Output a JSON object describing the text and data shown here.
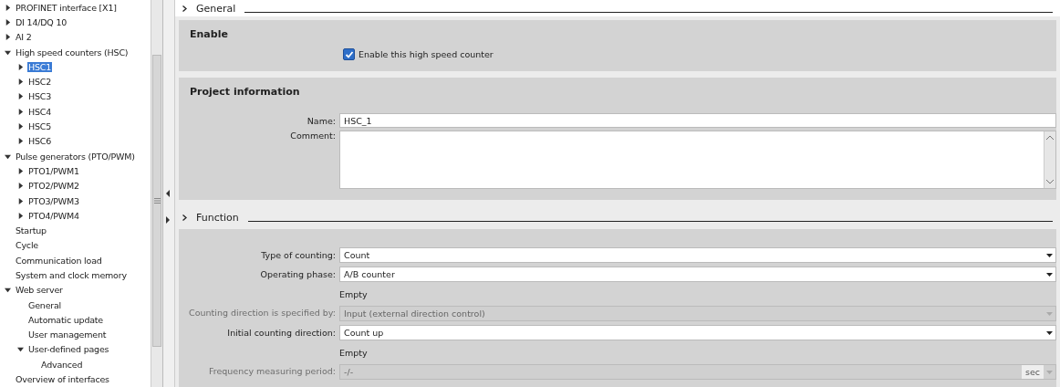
{
  "tree": [
    {
      "label": "PROFINET interface [X1]",
      "kind": "folder",
      "expanded": false,
      "selected": false
    },
    {
      "label": "DI 14/DQ 10",
      "kind": "folder",
      "expanded": false,
      "selected": false
    },
    {
      "label": "AI 2",
      "kind": "folder",
      "expanded": false,
      "selected": false
    },
    {
      "label": "High speed counters (HSC)",
      "kind": "folder",
      "expanded": true,
      "selected": false,
      "children": [
        {
          "label": "HSC1",
          "kind": "folder",
          "expanded": false,
          "selected": true
        },
        {
          "label": "HSC2",
          "kind": "folder",
          "expanded": false,
          "selected": false
        },
        {
          "label": "HSC3",
          "kind": "folder",
          "expanded": false,
          "selected": false
        },
        {
          "label": "HSC4",
          "kind": "folder",
          "expanded": false,
          "selected": false
        },
        {
          "label": "HSC5",
          "kind": "folder",
          "expanded": false,
          "selected": false
        },
        {
          "label": "HSC6",
          "kind": "folder",
          "expanded": false,
          "selected": false
        }
      ]
    },
    {
      "label": "Pulse generators (PTO/PWM)",
      "kind": "folder",
      "expanded": true,
      "selected": false,
      "children": [
        {
          "label": "PTO1/PWM1",
          "kind": "folder",
          "expanded": false,
          "selected": false
        },
        {
          "label": "PTO2/PWM2",
          "kind": "folder",
          "expanded": false,
          "selected": false
        },
        {
          "label": "PTO3/PWM3",
          "kind": "folder",
          "expanded": false,
          "selected": false
        },
        {
          "label": "PTO4/PWM4",
          "kind": "folder",
          "expanded": false,
          "selected": false
        }
      ]
    },
    {
      "label": "Startup",
      "kind": "leaf",
      "selected": false
    },
    {
      "label": "Cycle",
      "kind": "leaf",
      "selected": false
    },
    {
      "label": "Communication load",
      "kind": "leaf",
      "selected": false
    },
    {
      "label": "System and clock memory",
      "kind": "leaf",
      "selected": false
    },
    {
      "label": "Web server",
      "kind": "folder",
      "expanded": true,
      "selected": false,
      "children": [
        {
          "label": "General",
          "kind": "leaf",
          "selected": false
        },
        {
          "label": "Automatic update",
          "kind": "leaf",
          "selected": false
        },
        {
          "label": "User management",
          "kind": "leaf",
          "selected": false
        },
        {
          "label": "User-defined pages",
          "kind": "folder",
          "expanded": true,
          "selected": false,
          "children": [
            {
              "label": "Advanced",
              "kind": "leaf",
              "selected": false
            }
          ]
        }
      ]
    },
    {
      "label": "Overview of interfaces",
      "kind": "leaf",
      "selected": false
    }
  ],
  "general_header": {
    "title": "General"
  },
  "enable_section": {
    "title": "Enable",
    "checkbox": {
      "label": "Enable this high speed counter",
      "checked": true
    }
  },
  "project_section": {
    "title": "Project information",
    "fields": [
      {
        "kind": "text",
        "label": "Name:",
        "value": "HSC_1"
      },
      {
        "kind": "textarea",
        "label": "Comment:"
      }
    ]
  },
  "function_header": {
    "title": "Function",
    "expanded": false
  },
  "function_section": {
    "fields": [
      {
        "kind": "dropdown",
        "label": "Type of counting:",
        "value": "Count",
        "disabled": false
      },
      {
        "kind": "dropdown",
        "label": "Operating phase:",
        "value": "A/B counter",
        "disabled": false
      },
      {
        "kind": "note",
        "value": "Empty"
      },
      {
        "kind": "dropdown",
        "label": "Counting direction is specified by:",
        "value": "Input (external direction control)",
        "disabled": true
      },
      {
        "kind": "dropdown",
        "label": "Initial counting direction:",
        "value": "Count up",
        "disabled": false
      },
      {
        "kind": "note",
        "value": "Empty"
      },
      {
        "kind": "unit",
        "label": "Frequency measuring period:",
        "value": "-/-",
        "unit": "sec",
        "disabled": true
      }
    ]
  }
}
